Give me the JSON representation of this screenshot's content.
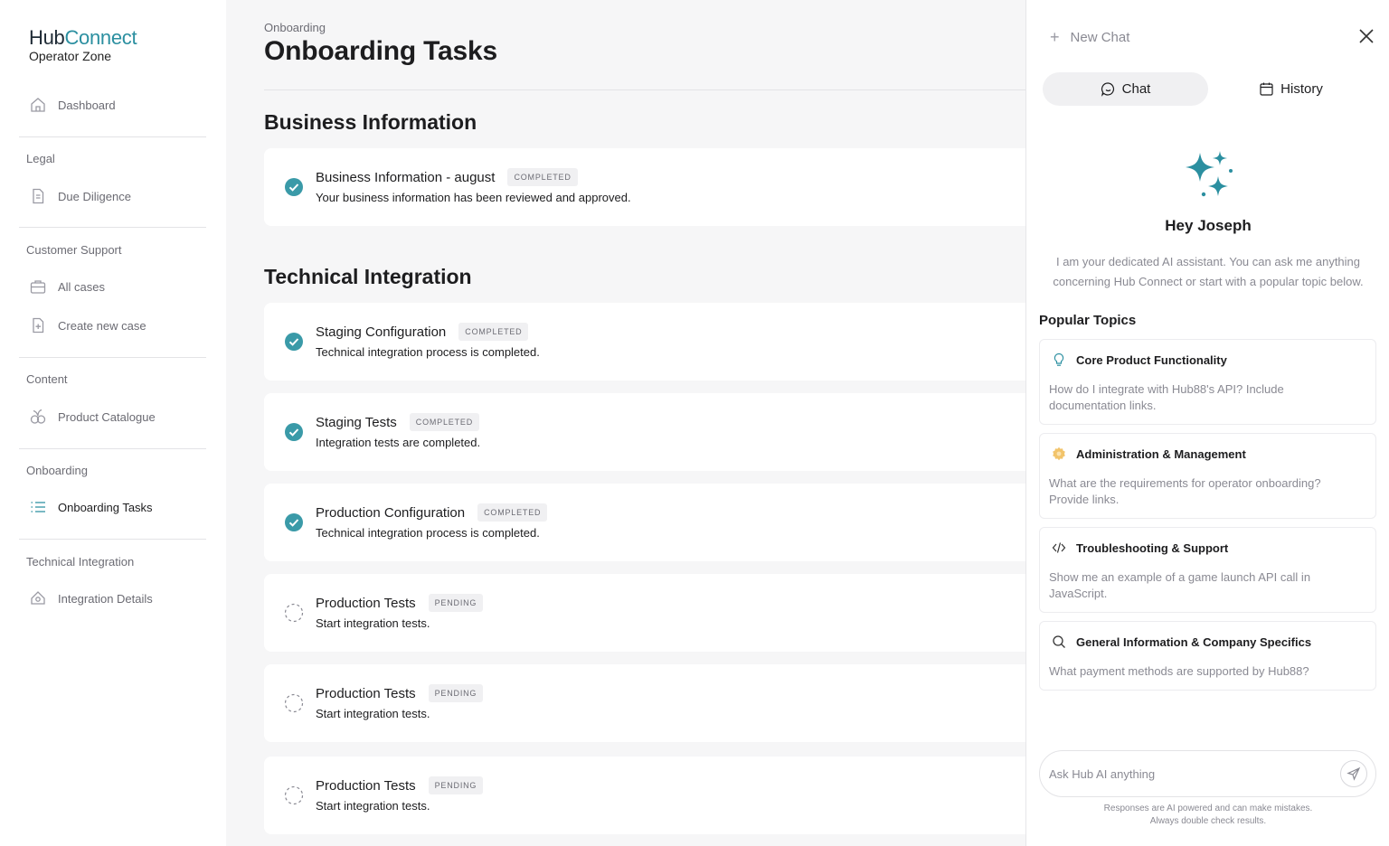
{
  "brand": {
    "hub": "Hub",
    "connect": "Connect",
    "subtitle": "Operator Zone"
  },
  "sidebar": {
    "dashboard": "Dashboard",
    "sections": [
      {
        "label": "Legal",
        "items": [
          {
            "label": "Due Diligence",
            "icon": "document-icon"
          }
        ]
      },
      {
        "label": "Customer Support",
        "items": [
          {
            "label": "All cases",
            "icon": "briefcase-icon"
          },
          {
            "label": "Create new case",
            "icon": "new-document-icon"
          }
        ]
      },
      {
        "label": "Content",
        "items": [
          {
            "label": "Product Catalogue",
            "icon": "catalogue-icon"
          }
        ]
      },
      {
        "label": "Onboarding",
        "items": [
          {
            "label": "Onboarding Tasks",
            "icon": "list-icon",
            "active": true
          }
        ]
      },
      {
        "label": "Technical Integration",
        "items": [
          {
            "label": "Integration Details",
            "icon": "integration-icon"
          }
        ]
      }
    ]
  },
  "main": {
    "breadcrumb": "Onboarding",
    "title": "Onboarding Tasks",
    "groups": [
      {
        "title": "Business Information",
        "tasks": [
          {
            "title": "Business Information - august",
            "status": "COMPLETED",
            "desc": "Your business information has been reviewed and approved."
          }
        ]
      },
      {
        "title": "Technical Integration",
        "tasks": [
          {
            "title": "Staging Configuration",
            "status": "COMPLETED",
            "desc": "Technical integration process is completed."
          },
          {
            "title": "Staging Tests",
            "status": "COMPLETED",
            "desc": "Integration tests are completed."
          },
          {
            "title": "Production Configuration",
            "status": "COMPLETED",
            "desc": "Technical integration process is completed."
          },
          {
            "title": "Production Tests",
            "status": "PENDING",
            "desc": "Start integration tests."
          },
          {
            "title": "Production Tests",
            "status": "PENDING",
            "desc": "Start integration tests."
          },
          {
            "title": "Production Tests",
            "status": "PENDING",
            "desc": "Start integration tests."
          }
        ]
      }
    ]
  },
  "chat": {
    "new_chat": "New Chat",
    "tabs": {
      "chat": "Chat",
      "history": "History"
    },
    "greeting": "Hey Joseph",
    "intro": "I am your dedicated AI assistant. You can ask me anything concerning Hub Connect or start with a popular topic below.",
    "popular_title": "Popular Topics",
    "topics": [
      {
        "title": "Core Product Functionality",
        "question": "How do I integrate with Hub88's API? Include documentation links.",
        "icon": "lightbulb-icon"
      },
      {
        "title": "Administration & Management",
        "question": "What are the requirements for operator onboarding? Provide links.",
        "icon": "gear-icon"
      },
      {
        "title": "Troubleshooting & Support",
        "question": "Show me an example of a game launch API call in JavaScript.",
        "icon": "code-icon"
      },
      {
        "title": "General Information & Company Specifics",
        "question": "What payment methods are supported by Hub88?",
        "icon": "search-icon"
      }
    ],
    "input_placeholder": "Ask Hub AI anything",
    "disclaimer_line1": "Responses are AI powered and can make mistakes.",
    "disclaimer_line2": "Always double check results."
  },
  "colors": {
    "accent": "#2b8fa0",
    "check": "#3a9aa8",
    "admin_icon": "#f2c46b"
  }
}
